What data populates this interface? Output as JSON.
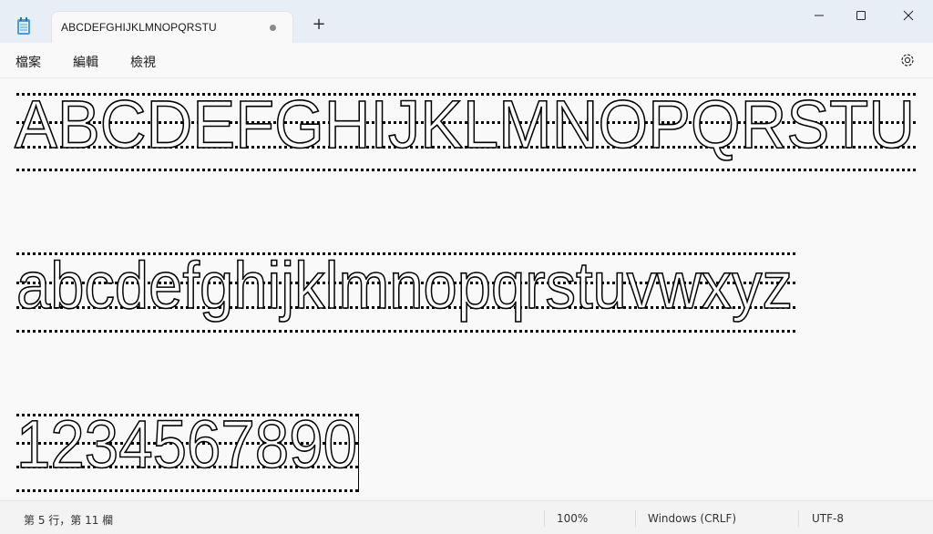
{
  "window": {
    "tab_title": "ABCDEFGHIJKLMNOPQRSTU",
    "new_tab": "+"
  },
  "menu": {
    "file": "檔案",
    "edit": "編輯",
    "view": "檢視"
  },
  "content": {
    "line1": "ABCDEFGHIJKLMNOPQRSTU",
    "line2": "abcdefghijklmnopqrstuvwxyz",
    "line3": "1234567890"
  },
  "status": {
    "position": "第 5 行，第 11 欄",
    "zoom": "100%",
    "line_ending": "Windows (CRLF)",
    "encoding": "UTF-8"
  },
  "icons": {
    "app": "notepad-icon",
    "minimize": "minimize-icon",
    "maximize": "maximize-icon",
    "close": "close-icon",
    "settings": "gear-icon"
  },
  "colors": {
    "titlebar": "#e8eef6",
    "editor_bg": "#f9f9f9",
    "text_outline": "#000000"
  }
}
